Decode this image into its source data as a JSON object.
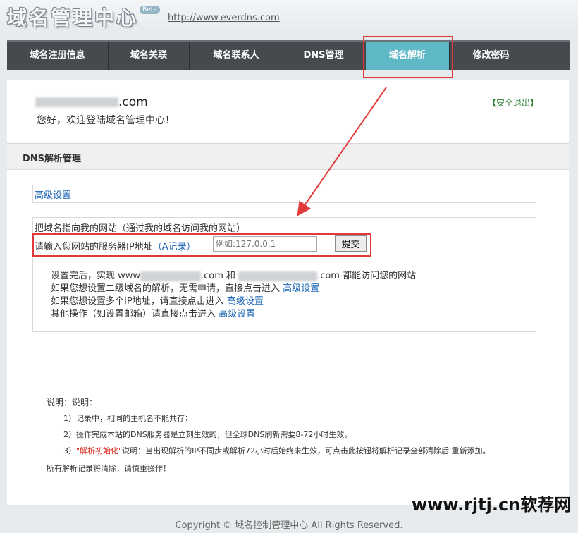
{
  "header": {
    "logo_text": "域名管理中心",
    "beta_badge": "Beta",
    "site_link": "http://www.everdns.com"
  },
  "nav": {
    "items": [
      {
        "label": "域名注册信息",
        "active": false
      },
      {
        "label": "域名关联",
        "active": false
      },
      {
        "label": "域名联系人",
        "active": false
      },
      {
        "label": "DNS管理",
        "active": false
      },
      {
        "label": "域名解析",
        "active": true
      },
      {
        "label": "修改密码",
        "active": false
      }
    ]
  },
  "account": {
    "domain_suffix": ".com",
    "welcome": "您好，欢迎登陆域名管理中心！",
    "logout": "【安全退出】"
  },
  "section": {
    "title": "DNS解析管理"
  },
  "advanced": {
    "link_label": "高级设置"
  },
  "form": {
    "title": "把域名指向我的网站（通过我的域名访问我的网站）",
    "prompt_text": "请输入您网站的服务器IP地址",
    "record_link": "（A记录）",
    "ip_placeholder": "例如:127.0.0.1",
    "submit_label": "提交"
  },
  "info": {
    "line1_prefix": "设置完后，实现 www",
    "line1_mid": ".com 和",
    "line1_suffix": ".com 都能访问您的网站",
    "line2_text": "如果您想设置二级域名的解析，无需申请，直接点击进入",
    "line3_text": "如果您想设置多个IP地址，请直接点击进入",
    "line4_text": "其他操作（如设置邮箱）请直接点击进入",
    "link_label": "高级设置"
  },
  "notes": {
    "heading": "说明：说明：",
    "item1": "1）记录中，相同的主机名不能共存；",
    "item2": "2）操作完成本站的DNS服务器是立刻生效的，但全球DNS刷新需要8-72小时生效。",
    "item3_prefix": "3）",
    "item3_red": "\"解析初始化\"",
    "item3_text": "说明：当出现解析的IP不同步或解析72小时后始终未生效，可点击此按钮将解析记录全部清除后 重新添加。",
    "item4": "所有解析记录将清除，请慎重操作！"
  },
  "watermark": "www.rjtj.cn软荐网",
  "footer": "Copyright © 域名控制管理中心 All Rights Reserved.",
  "colors": {
    "nav_bg": "#454a4f",
    "nav_active": "#5fb8c6",
    "annotation_red": "#e23a3a",
    "link_blue": "#1a64b5",
    "logout_green": "#2f7d32"
  }
}
